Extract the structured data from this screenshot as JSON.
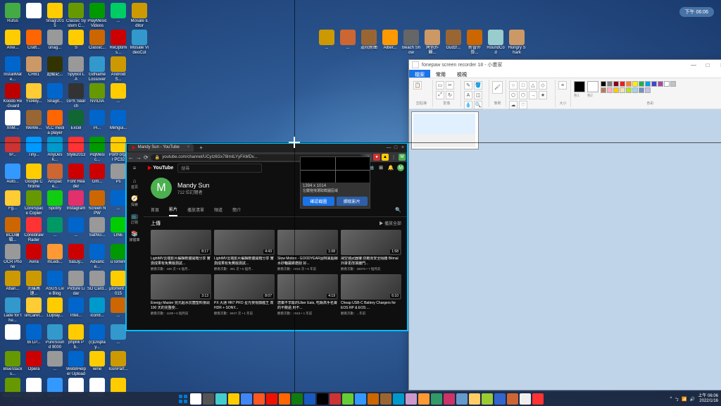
{
  "badge": "下午 06:06",
  "crosshair_info": {
    "dim": "1394 x 1014",
    "hint": "左鍵拖曳選取截圖區域",
    "btn_confirm": "確認截圖",
    "btn_full": "擷取影片"
  },
  "browser": {
    "tab_title": "Mandy Sun - YouTube",
    "url": "youtube.com/channel/UCyIz6Gx78ImILYyFAMDv...",
    "youtube": {
      "logo": "YouTube",
      "search_placeholder": "搜尋",
      "channel_name": "Mandy Sun",
      "channel_subs": "712 位訂閱者",
      "avatar_letter": "M",
      "tabs": [
        "首頁",
        "影片",
        "播放清單",
        "頻道",
        "簡介"
      ],
      "section_title": "上傳",
      "section_all": "▶ 播放全部",
      "videos_row1": [
        {
          "dur": "8:17",
          "title": "LightMV云端影片編輯軟體開箱分享 實測成果有免費版測試...",
          "meta": "觀看次數：430 次 • 5 個月..."
        },
        {
          "dur": "4:43",
          "title": "LightMV云端影片編輯軟體開箱分享 實測成果有免費版測試...",
          "meta": "觀看次數：391 次 • 5 個月..."
        },
        {
          "dur": "1:08",
          "title": "Slow Motion - GOODYEAR固特異超細水砂輪麗細磨削 好...",
          "meta": "觀看次數：2015 次 • 5 年前"
        },
        {
          "dur": "1:58",
          "title": "飛空城武器樓 防範周安全隔牆 Bitmal外掛更改填牆門...",
          "meta": "觀看次數：26070 • 7 個月前"
        }
      ],
      "videos_row2": [
        {
          "dur": "3:13",
          "title": "Energy Master 完元超水抗菌塑料接頭100 天的完整使...",
          "meta": "觀看次數：1188 • 5 個月前"
        },
        {
          "dur": "8:07",
          "title": "PX 大通 HR7 PRO 星光夜視旗艦王 真 HDR + SONY...",
          "meta": "觀看次數：5947 次 • 1 年前"
        },
        {
          "dur": "4:19",
          "title": "唐策不辛酸的Uber Eats, 吃飯高手名賣的不饒過 用不...",
          "meta": "觀看次數：4915 • 1 年前"
        },
        {
          "dur": "6:10",
          "title": "Cheap USB-C Battery Chargers for EOS RP & EOS ...",
          "meta": "觀看次數：...年前"
        }
      ],
      "sidebar": [
        {
          "icon": "≡",
          "label": ""
        },
        {
          "icon": "⌂",
          "label": "首頁"
        },
        {
          "icon": "🧭",
          "label": "探索"
        },
        {
          "icon": "📺",
          "label": "訂閱"
        },
        {
          "icon": "📚",
          "label": "媒體庫"
        }
      ]
    }
  },
  "paint": {
    "title": "fonepaw screen recorder 18 - 小畫家",
    "tabs": [
      "檔案",
      "常用",
      "檢視"
    ],
    "ribbon_groups": [
      "剪貼簿",
      "影像",
      "工具",
      "筆刷",
      "圖形",
      "大小",
      "色彩"
    ],
    "colors_row1": [
      "#000",
      "#7f7f7f",
      "#880015",
      "#ed1c24",
      "#ff7f27",
      "#fff200",
      "#22b14c",
      "#00a2e8",
      "#3f48cc",
      "#a349a4"
    ],
    "colors_row2": [
      "#fff",
      "#c3c3c3",
      "#b97a57",
      "#ffaec9",
      "#ffc90e",
      "#efe4b0",
      "#b5e61d",
      "#99d9ea",
      "#7092be",
      "#c8bfe7"
    ]
  },
  "desktop_icons": [
    {
      "c": "#4a4",
      "l": "Rufus"
    },
    {
      "c": "#fc0",
      "l": "Anvi..."
    },
    {
      "c": "#06c",
      "l": "InstallMate..."
    },
    {
      "c": "#b00",
      "l": "Koodo Re-Guard"
    },
    {
      "c": "#fff",
      "l": "XnM..."
    },
    {
      "c": "#c33",
      "l": "IP..."
    },
    {
      "c": "#39f",
      "l": "Auto..."
    },
    {
      "c": "#fc3",
      "l": "Fg..."
    },
    {
      "c": "#c60",
      "l": "BCD编辑..."
    },
    {
      "c": "#999",
      "l": "OCR Phone"
    },
    {
      "c": "#c90",
      "l": "Aban..."
    },
    {
      "c": "#39c",
      "l": "Lade for the..."
    },
    {
      "c": "#fff",
      "l": ""
    },
    {
      "c": "#690",
      "l": "BlueStacks..."
    },
    {
      "c": "#690",
      "l": "BlueStacks"
    },
    {
      "c": "#fff",
      "l": ""
    },
    {
      "c": "#f60",
      "l": "Craft..."
    },
    {
      "c": "#c96",
      "l": "CRB1"
    },
    {
      "c": "#fc3",
      "l": "Yst48y..."
    },
    {
      "c": "#963",
      "l": "WeWe..."
    },
    {
      "c": "#09f",
      "l": "Tiny..."
    },
    {
      "c": "#fc0",
      "l": "Google Chrome"
    },
    {
      "c": "#690",
      "l": "CoreSpace Copier"
    },
    {
      "c": "#f33",
      "l": "Coreldraw Rader"
    },
    {
      "c": "#c00",
      "l": "Avira"
    },
    {
      "c": "#c90",
      "l": "光碟高速..."
    },
    {
      "c": "#fc3",
      "l": "unCaret..."
    },
    {
      "c": "#06c",
      "l": "Bi LP..."
    },
    {
      "c": "#c00",
      "l": "Opera"
    },
    {
      "c": "#fff",
      "l": "Snag!2015"
    },
    {
      "c": "#fc0",
      "l": "Snag!2015"
    },
    {
      "c": "#999",
      "l": "unag..."
    },
    {
      "c": "#330",
      "l": "超級記..."
    },
    {
      "c": "#06c",
      "l": "Snagit..."
    },
    {
      "c": "#f60",
      "l": "VLC media player"
    },
    {
      "c": "#09c",
      "l": "AnyDesk..."
    },
    {
      "c": "#c63",
      "l": "Airspace..."
    },
    {
      "c": "#1c1",
      "l": "Spotify"
    },
    {
      "c": "#096",
      "l": "..."
    },
    {
      "c": "#f93",
      "l": "mLedi..."
    },
    {
      "c": "#06c",
      "l": "ASUS Live Blog"
    },
    {
      "c": "#fc0",
      "l": "LDplay..."
    },
    {
      "c": "#39c",
      "l": "PureSound 9000"
    },
    {
      "c": "#999",
      "l": "..."
    },
    {
      "c": "#39f",
      "l": "5kComse..."
    },
    {
      "c": "#690",
      "l": "Classic System C..."
    },
    {
      "c": "#fc0",
      "l": "S"
    },
    {
      "c": "#999",
      "l": "SpyBot LA"
    },
    {
      "c": "#333",
      "l": "GPX Search"
    },
    {
      "c": "#163",
      "l": "Excel"
    },
    {
      "c": "#f33",
      "l": "Style2013"
    },
    {
      "c": "#c00",
      "l": "Font Reader"
    },
    {
      "c": "#e1306c",
      "l": "Instagram"
    },
    {
      "c": "#06c",
      "l": "..."
    },
    {
      "c": "#c00",
      "l": "SasJy..."
    },
    {
      "c": "#999",
      "l": "Picture Lidar"
    },
    {
      "c": "#06c",
      "l": "Intel..."
    },
    {
      "c": "#fc0",
      "l": "phpMi Pb.."
    },
    {
      "c": "#06c",
      "l": "Web8Helper Uploader"
    },
    {
      "c": "#fff",
      "l": "..."
    },
    {
      "c": "#090",
      "l": "PlayMesic Videos"
    },
    {
      "c": "#c60",
      "l": "Classic..."
    },
    {
      "c": "#39c",
      "l": "GdName Lossover"
    },
    {
      "c": "#690",
      "l": "NVIDIA"
    },
    {
      "c": "#06c",
      "l": "Pi..."
    },
    {
      "c": "#090",
      "l": "PiqMesic..."
    },
    {
      "c": "#c00",
      "l": "Gm..."
    },
    {
      "c": "#c60",
      "l": "Screen NPW"
    },
    {
      "c": "#999",
      "l": "SatNG..."
    },
    {
      "c": "#06c",
      "l": "Advance..."
    },
    {
      "c": "#999",
      "l": "SD Card..."
    },
    {
      "c": "#09c",
      "l": "icon8..."
    },
    {
      "c": "#06c",
      "l": "(c)Display..."
    },
    {
      "c": "#fc0",
      "l": "wine"
    },
    {
      "c": "#fff",
      "l": "Recover..."
    },
    {
      "c": "#0c6",
      "l": "..."
    },
    {
      "c": "#c00",
      "l": "ReOptimis..."
    },
    {
      "c": "#c90",
      "l": "Android S..."
    },
    {
      "c": "#fc0",
      "l": "..."
    },
    {
      "c": "#06c",
      "l": "Mimgui..."
    },
    {
      "c": "#fc0",
      "l": "PortForger PC32"
    },
    {
      "c": "#999",
      "l": "Ps"
    },
    {
      "c": "#06c",
      "l": "..."
    },
    {
      "c": "#0c0",
      "l": "LINE"
    },
    {
      "c": "#090",
      "l": "uTorrent"
    },
    {
      "c": "#fc0",
      "l": "μtorrent 2015"
    },
    {
      "c": "#c60",
      "l": "..."
    },
    {
      "c": "#39c",
      "l": "..."
    },
    {
      "c": "#c90",
      "l": "IconPart..."
    },
    {
      "c": "#fc0",
      "l": "..."
    },
    {
      "c": "#c90",
      "l": "Mosale Editor"
    },
    {
      "c": "#39c",
      "l": "Mosale VideoCut"
    }
  ],
  "desktop_icons_r2": [
    {
      "c": "#c90",
      "l": "..."
    },
    {
      "c": "#c63",
      "l": "..."
    },
    {
      "c": "#963",
      "l": "道院新曲"
    },
    {
      "c": "#f90",
      "l": "Alber..."
    },
    {
      "c": "#666",
      "l": "Beach Show"
    },
    {
      "c": "#c96",
      "l": "烤色炸雞..."
    },
    {
      "c": "#963",
      "l": "Gudz!..."
    },
    {
      "c": "#c60",
      "l": "新晉外掛..."
    },
    {
      "c": "#9cc",
      "l": "RoundCod"
    },
    {
      "c": "#c96",
      "l": "Hungry Shark"
    }
  ],
  "taskbar": {
    "items": [
      "start",
      "search",
      "task-view",
      "widgets",
      "file-explorer",
      "edge",
      "chrome",
      "firefox",
      "vlc",
      "excel",
      "word",
      "terminal",
      "snip",
      "app1",
      "app2",
      "app3",
      "app4",
      "app5",
      "app6",
      "app7",
      "app8",
      "app9",
      "app10",
      "app11",
      "app12",
      "app13",
      "app14",
      "paint",
      "recorder"
    ],
    "time": "上午 06:06",
    "date": "2022/1/16"
  }
}
